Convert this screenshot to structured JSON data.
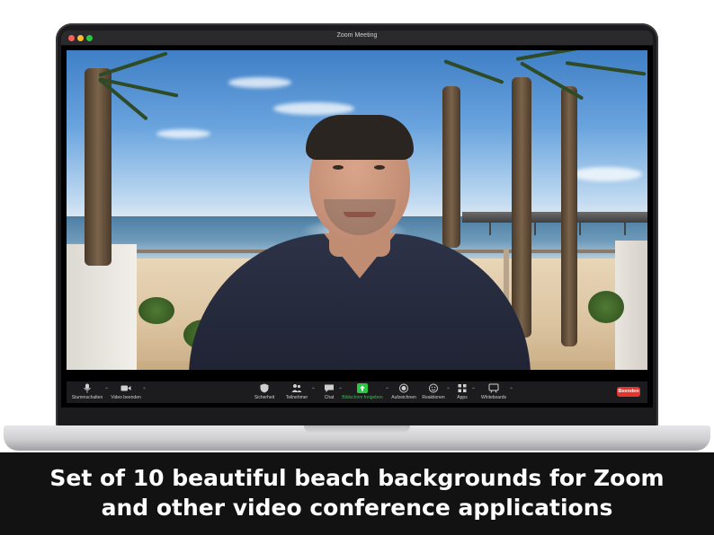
{
  "window": {
    "title": "Zoom Meeting"
  },
  "toolbar": {
    "left": [
      {
        "label": "Stummschalten",
        "icon": "microphone-icon"
      },
      {
        "label": "Video beenden",
        "icon": "video-camera-icon"
      }
    ],
    "center": [
      {
        "label": "Sicherheit",
        "icon": "shield-icon"
      },
      {
        "label": "Teilnehmer",
        "icon": "participants-icon"
      },
      {
        "label": "Chat",
        "icon": "chat-icon"
      },
      {
        "label": "Bildschirm freigeben",
        "icon": "share-screen-icon"
      },
      {
        "label": "Aufzeichnen",
        "icon": "record-icon"
      },
      {
        "label": "Reaktionen",
        "icon": "reactions-icon"
      },
      {
        "label": "Apps",
        "icon": "apps-icon"
      },
      {
        "label": "Whiteboards",
        "icon": "whiteboard-icon"
      }
    ],
    "end_label": "Beenden"
  },
  "colors": {
    "accent_green": "#28c840",
    "end_red": "#e5342c",
    "toolbar_bg": "#1c1c1e"
  },
  "caption": {
    "line1": "Set of 10 beautiful beach backgrounds for Zoom",
    "line2": "and other video conference applications"
  }
}
